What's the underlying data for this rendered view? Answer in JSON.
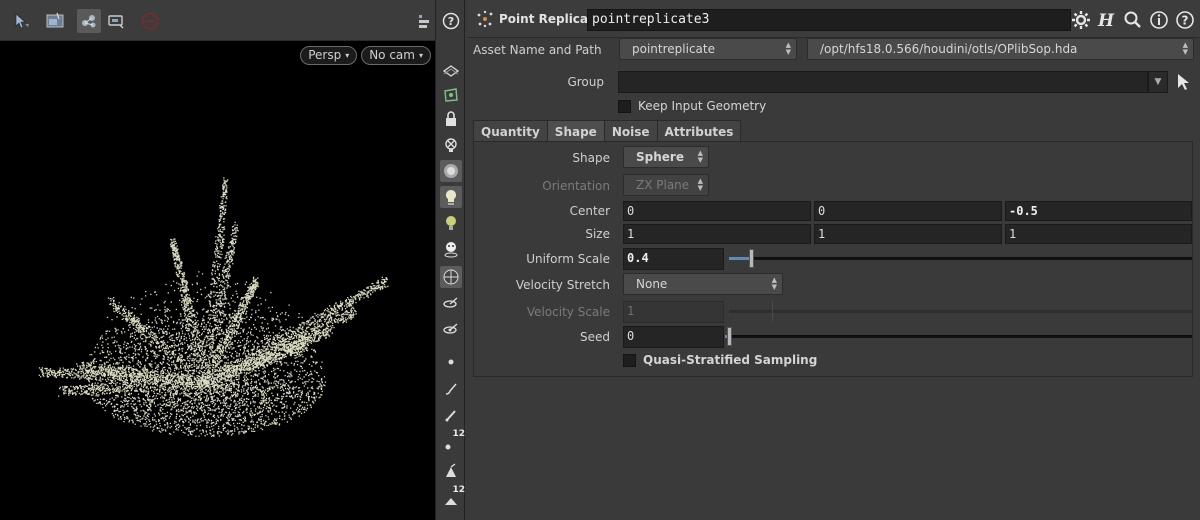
{
  "viewport": {
    "view_menu": "Persp",
    "camera_menu": "No cam",
    "toolbar_icons": [
      "select-arrow-icon",
      "snapshot-icon",
      "link-nodes-icon",
      "display-flipbook-icon",
      "stop-icon"
    ],
    "right_toolbar_icons": [
      "display-options-icon",
      "help-icon"
    ],
    "scatter_color": "#d9d9c0"
  },
  "viewer_side_toolbar": {
    "icons": [
      "ghost-other-objects-icon",
      "template-geometry-icon",
      "lock-icon",
      "hide-other-objects-icon",
      "background-image-icon",
      "headlight-icon",
      "light-bulb-icon",
      "isolate-icon",
      "wireframe-shading-icon",
      "display-normals-icon",
      "display-point-normals-icon",
      "point-marker-icon",
      "brush-icon",
      "pen-icon",
      "point-number-icon",
      "clean-icon",
      "primitive-number-icon"
    ],
    "badge_12a": "12",
    "badge_12b": "12"
  },
  "params": {
    "header": {
      "node_type": "Point Replicate",
      "node_name": "pointreplicate3",
      "icons": [
        "gear-icon",
        "houdini-help-h-icon",
        "search-icon",
        "info-icon",
        "help-icon"
      ]
    },
    "asset": {
      "label": "Asset Name and Path",
      "name": "pointreplicate",
      "path": "/opt/hfs18.0.566/houdini/otls/OPlibSop.hda"
    },
    "group": {
      "label": "Group",
      "value": ""
    },
    "keep_input": {
      "label": "Keep Input Geometry",
      "checked": false
    },
    "tabs": [
      {
        "label": "Quantity"
      },
      {
        "label": "Shape"
      },
      {
        "label": "Noise"
      },
      {
        "label": "Attributes"
      }
    ],
    "active_tab": "Shape",
    "shape": {
      "label": "Shape",
      "value": "Sphere"
    },
    "orientation": {
      "label": "Orientation",
      "value": "ZX Plane"
    },
    "center": {
      "label": "Center",
      "x": "0",
      "y": "0",
      "z": "-0.5"
    },
    "size": {
      "label": "Size",
      "x": "1",
      "y": "1",
      "z": "1"
    },
    "uniform_scale": {
      "label": "Uniform Scale",
      "value": "0.4",
      "slider_fraction": 0.04
    },
    "velocity_stretch": {
      "label": "Velocity Stretch",
      "value": "None"
    },
    "velocity_scale": {
      "label": "Velocity Scale",
      "value": "1"
    },
    "seed": {
      "label": "Seed",
      "value": "0",
      "slider_fraction": 0.0
    },
    "quasi": {
      "label": "Quasi-Stratified Sampling",
      "checked": false
    }
  }
}
